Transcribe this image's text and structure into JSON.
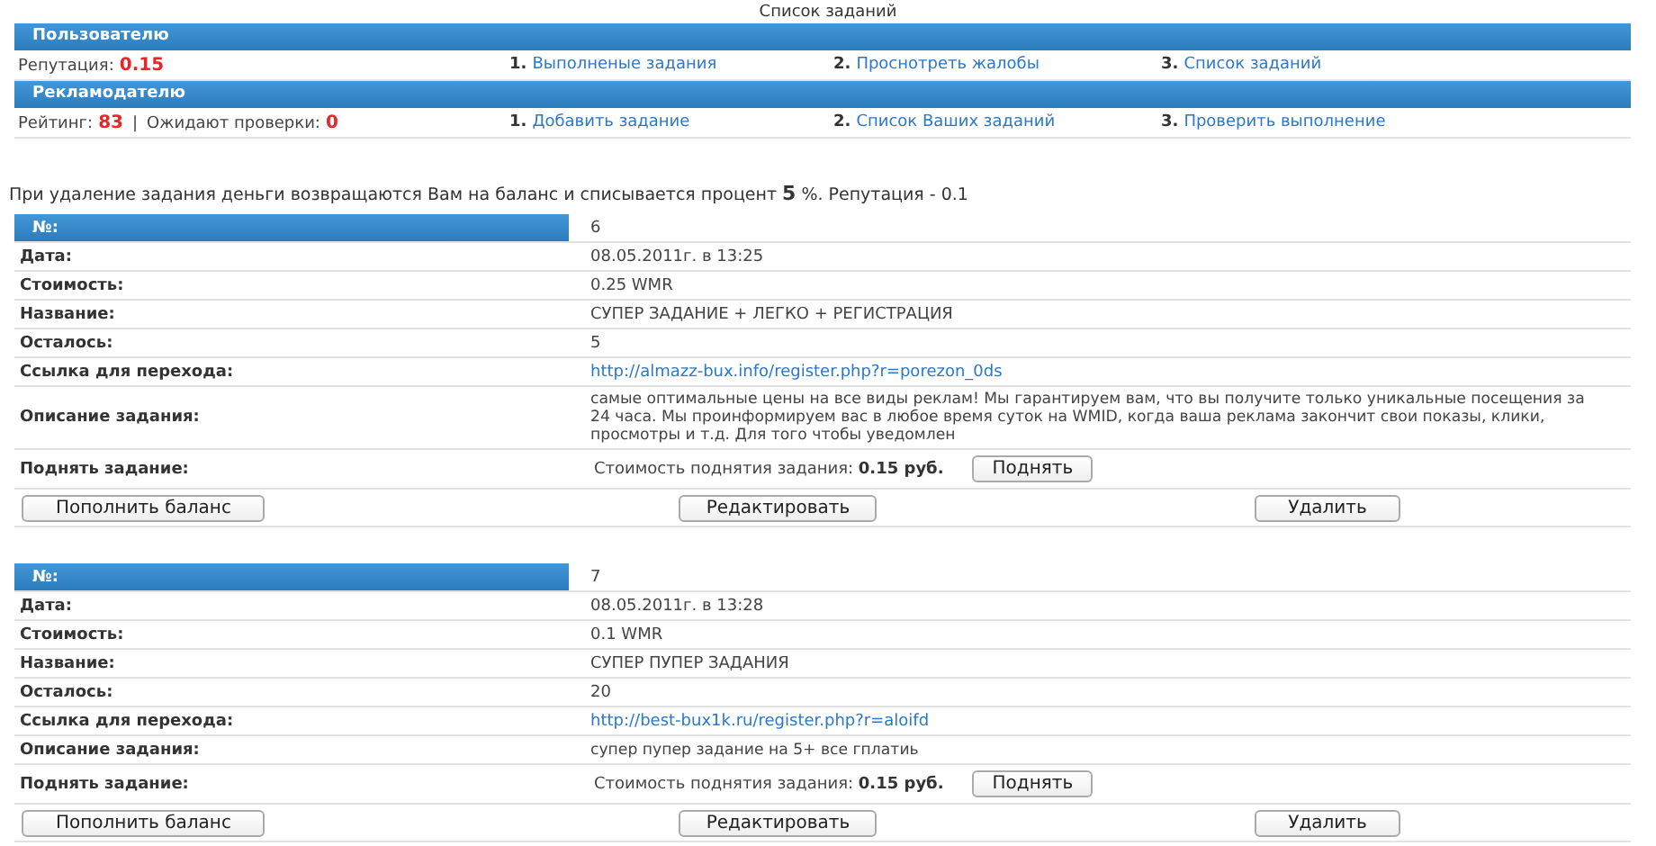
{
  "title": "Список заданий",
  "sections": [
    {
      "heading": "Пользователю",
      "stats": [
        {
          "label": "Репутация:",
          "value": "0.15"
        }
      ],
      "links": [
        {
          "number": "1.",
          "text": "Выполненые задания"
        },
        {
          "number": "2.",
          "text": "Проснотреть жалобы"
        },
        {
          "number": "3.",
          "text": "Список заданий"
        }
      ]
    },
    {
      "heading": "Рекламодателю",
      "separator": "|",
      "stats": [
        {
          "label": "Рейтинг:",
          "value": "83"
        },
        {
          "label": "Ожидают проверки:",
          "value": "0"
        }
      ],
      "links": [
        {
          "number": "1.",
          "text": "Добавить задание"
        },
        {
          "number": "2.",
          "text": "Список Ваших заданий"
        },
        {
          "number": "3.",
          "text": "Проверить выполнение"
        }
      ]
    }
  ],
  "notice": "При удаление задания деньги возвращаются Вам на баланс и списывается процент **5** %. Репутация - 0.1",
  "tasks": [
    {
      "fields": [
        {
          "kind": "header",
          "label": "№:",
          "value": "6"
        },
        {
          "kind": "text",
          "label": "Дата:",
          "value": "08.05.2011г. в 13:25"
        },
        {
          "kind": "text",
          "label": "Стоимость:",
          "value": "0.25 WMR"
        },
        {
          "kind": "text",
          "label": "Название:",
          "value": "СУПЕР ЗАДАНИЕ + ЛЕГКО + РЕГИСТРАЦИЯ"
        },
        {
          "kind": "text",
          "label": "Осталось:",
          "value": "5"
        },
        {
          "kind": "link",
          "label": "Ссылка для перехода:",
          "value": "http://almazz-bux.info/register.php?r=porezon_0ds"
        },
        {
          "kind": "description",
          "label": "Описание задания:",
          "value": " самые оптимальные цены на все виды реклам! Мы гарантируем вам, что вы получите только уникальные посещения за 24 часа. Мы проинформируем вас в любое время суток на WMID, когда ваша реклама закончит свои показы, клики, просмотры и т.д. Для того чтобы уведомлен"
        },
        {
          "kind": "raise",
          "label": "Поднять задание:",
          "value": "Стоимость поднятия задания: **0.15 руб.**",
          "button": "Поднять"
        }
      ],
      "actions": [
        "Пополнить баланс",
        "Редактировать",
        "Удалить"
      ]
    },
    {
      "fields": [
        {
          "kind": "header",
          "label": "№:",
          "value": "7"
        },
        {
          "kind": "text",
          "label": "Дата:",
          "value": "08.05.2011г. в 13:28"
        },
        {
          "kind": "text",
          "label": "Стоимость:",
          "value": "0.1 WMR"
        },
        {
          "kind": "text",
          "label": "Название:",
          "value": "СУПЕР ПУПЕР ЗАДАНИЯ"
        },
        {
          "kind": "text",
          "label": "Осталось:",
          "value": "20"
        },
        {
          "kind": "link",
          "label": "Ссылка для перехода:",
          "value": "http://best-bux1k.ru/register.php?r=aloifd"
        },
        {
          "kind": "description",
          "label": "Описание задания:",
          "value": "супер пупер задание на 5+ все гплатиь"
        },
        {
          "kind": "raise",
          "label": "Поднять задание:",
          "value": "Стоимость поднятия задания: **0.15 руб.**",
          "button": "Поднять"
        }
      ],
      "actions": [
        "Пополнить баланс",
        "Редактировать",
        "Удалить"
      ]
    }
  ]
}
